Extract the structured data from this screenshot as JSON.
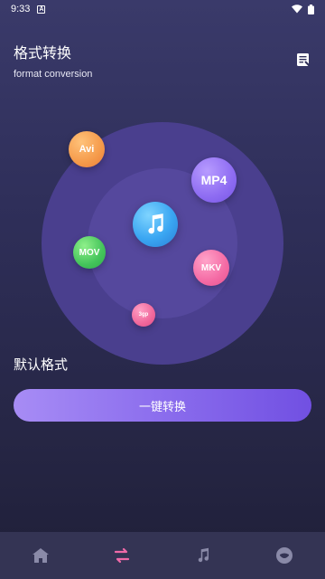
{
  "status_bar": {
    "time": "9:33",
    "notification_icon": "A"
  },
  "header": {
    "title": "格式转换",
    "subtitle": "format conversion",
    "doc_icon": "document-list-icon"
  },
  "formats": {
    "avi": "Avi",
    "mp4": "MP4",
    "mov": "MOV",
    "mkv": "MKV",
    "gp3": "3gp",
    "center_icon": "music-note-icon"
  },
  "main": {
    "default_format_label": "默认格式",
    "convert_button_label": "一键转换"
  },
  "bottom_nav": {
    "items": [
      {
        "name": "home",
        "icon": "home-icon",
        "active": false
      },
      {
        "name": "convert",
        "icon": "convert-icon",
        "active": true
      },
      {
        "name": "music",
        "icon": "music-icon",
        "active": false
      },
      {
        "name": "profile",
        "icon": "profile-icon",
        "active": false
      }
    ]
  },
  "colors": {
    "accent": "#7150e2",
    "nav_active": "#f06aa8",
    "nav_inactive": "#8a8aa8"
  }
}
